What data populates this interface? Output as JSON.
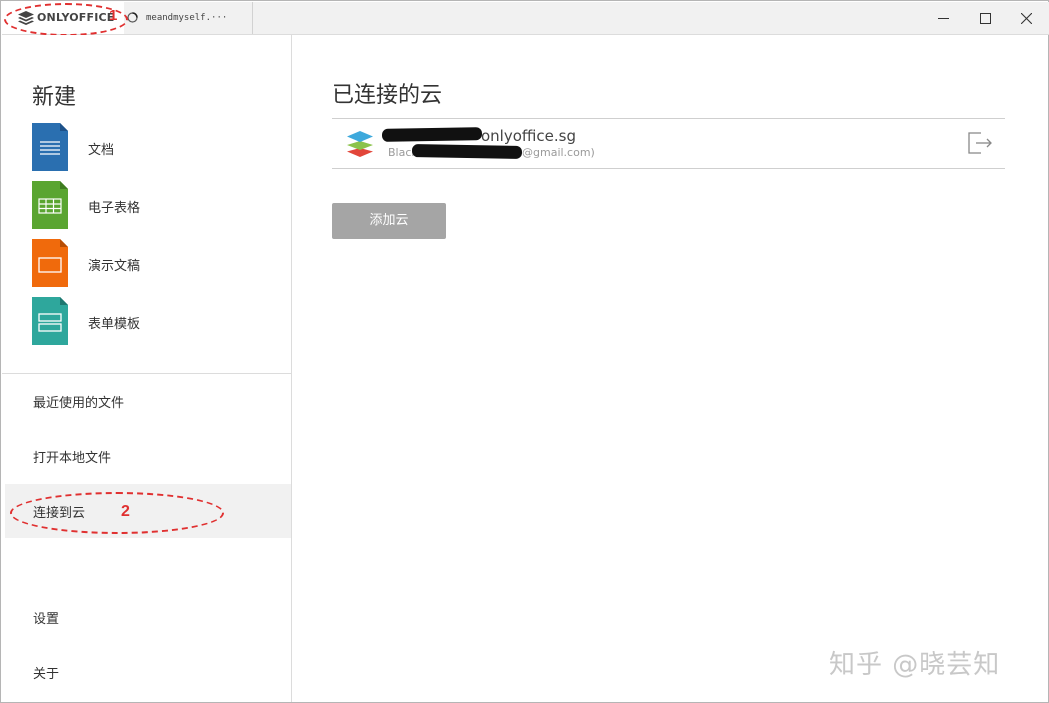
{
  "titlebar": {
    "app_name": "ONLYOFFICE",
    "doc_tab_label": "meandmyself.···"
  },
  "annotations": {
    "mark1": "1",
    "mark2": "2"
  },
  "sidebar": {
    "new_title": "新建",
    "new_items": [
      {
        "label": "文档",
        "color": "#2a6fb0"
      },
      {
        "label": "电子表格",
        "color": "#5aa531"
      },
      {
        "label": "演示文稿",
        "color": "#f06a0c"
      },
      {
        "label": "表单模板",
        "color": "#2ea79c"
      }
    ],
    "nav_items": [
      {
        "label": "最近使用的文件"
      },
      {
        "label": "打开本地文件"
      },
      {
        "label": "连接到云",
        "active": true
      },
      {
        "label": "设置"
      },
      {
        "label": "关于"
      }
    ]
  },
  "main": {
    "title": "已连接的云",
    "clouds": [
      {
        "portal": "onlyoffice.sg",
        "account_prefix": "Black",
        "account_suffix": "@gmail.com)"
      }
    ],
    "add_cloud_label": "添加云"
  },
  "watermark": "知乎 @晓芸知"
}
